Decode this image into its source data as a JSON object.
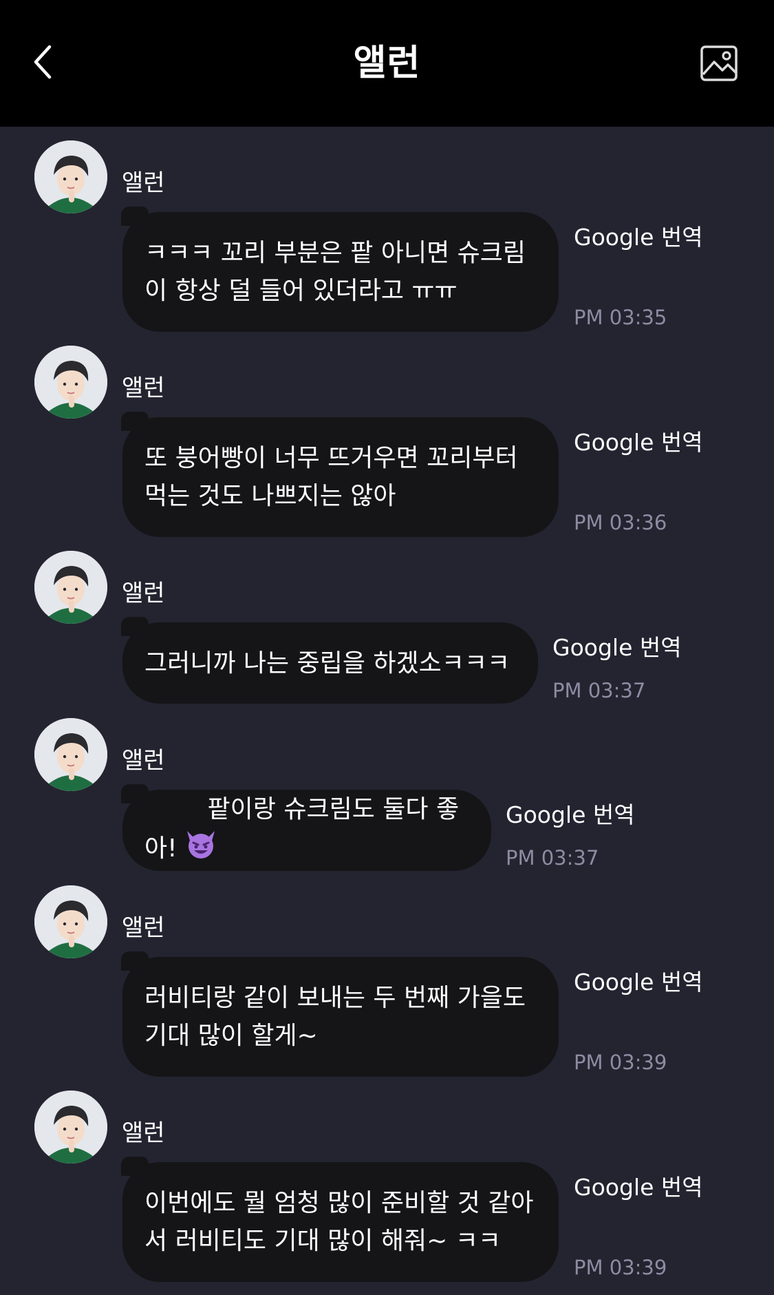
{
  "header": {
    "title": "앨런"
  },
  "messages": [
    {
      "sender": "앨런",
      "text": "ㅋㅋㅋ 꼬리 부분은 팥 아니면 슈크림\n이 항상 덜 들어 있더라고 ㅠㅠ",
      "translate_label": "Google 번역",
      "time": "PM 03:35"
    },
    {
      "sender": "앨런",
      "text": "또 붕어빵이 너무 뜨거우면 꼬리부터\n먹는 것도 나쁘지는 않아",
      "translate_label": "Google 번역",
      "time": "PM 03:36"
    },
    {
      "sender": "앨런",
      "text": "그러니까 나는 중립을 하겠소ㅋㅋㅋ",
      "translate_label": "Google 번역",
      "time": "PM 03:37"
    },
    {
      "sender": "앨런",
      "text": "팥이랑 슈크림도 둘다 좋아!",
      "emoji": "smiling-devil",
      "translate_label": "Google 번역",
      "time": "PM 03:37"
    },
    {
      "sender": "앨런",
      "text": "러비티랑 같이 보내는 두 번째 가을도\n기대 많이 할게~",
      "translate_label": "Google 번역",
      "time": "PM 03:39"
    },
    {
      "sender": "앨런",
      "text": "이번에도 뭘 엄청 많이 준비할 것 같아\n서 러비티도 기대 많이 해줘~ ㅋㅋ",
      "translate_label": "Google 번역",
      "time": "PM 03:39"
    }
  ],
  "colors": {
    "header_bg": "#000000",
    "chat_bg": "#232430",
    "bubble_bg": "#151518",
    "time_text": "#8c8ca2"
  }
}
